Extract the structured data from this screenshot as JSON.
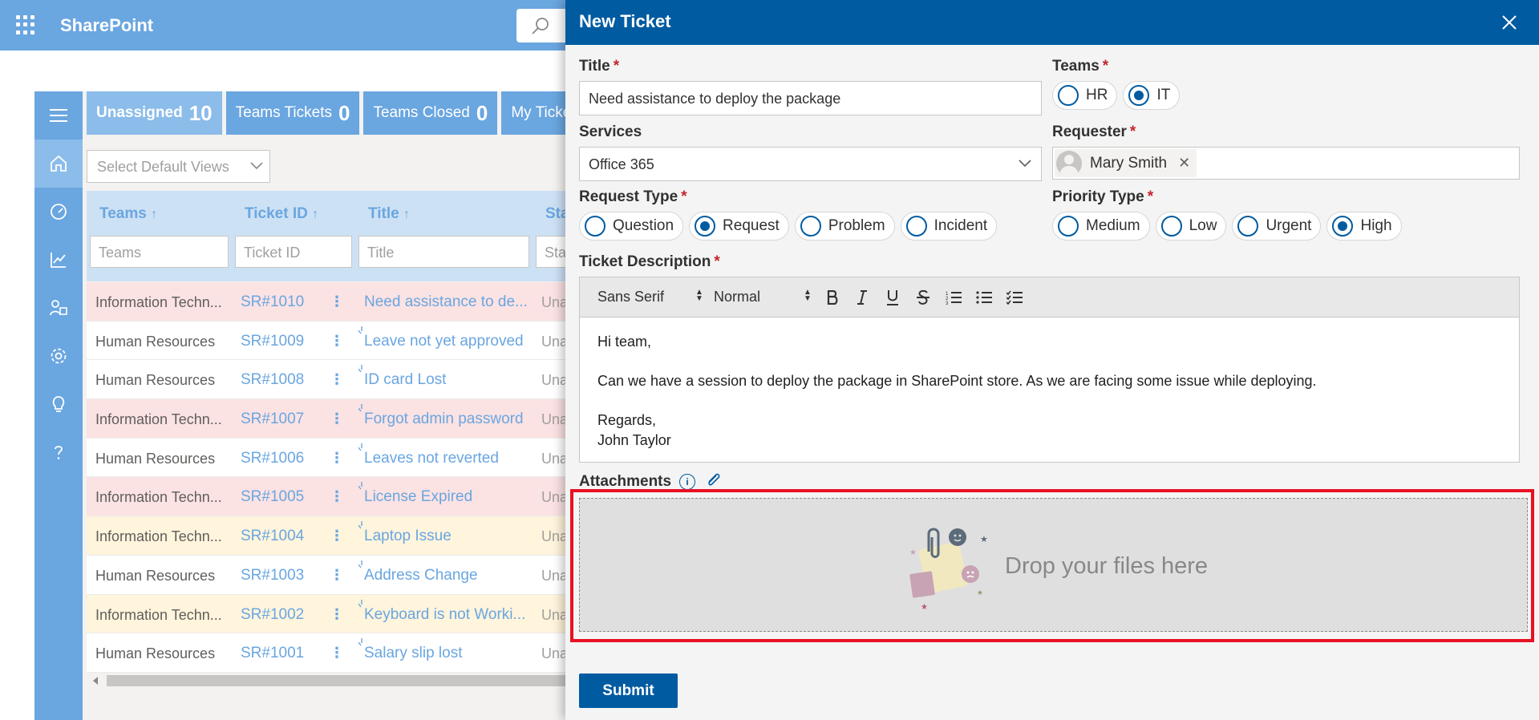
{
  "app": {
    "brand": "SharePoint"
  },
  "tabs": [
    {
      "label": "Unassigned",
      "count": "10"
    },
    {
      "label": "Teams Tickets",
      "count": "0"
    },
    {
      "label": "Teams Closed",
      "count": "0"
    },
    {
      "label": "My Tickets",
      "count": ""
    }
  ],
  "views": {
    "placeholder": "Select Default Views"
  },
  "grid": {
    "columns": [
      "Teams",
      "Ticket ID",
      "Title",
      "Sta"
    ],
    "sort_icon": "↑",
    "filters": [
      "Teams",
      "Ticket ID",
      "Title",
      "Sta"
    ],
    "rows": [
      {
        "team": "Information Techn...",
        "id": "SR#1010",
        "title": "Need assistance to de...",
        "status": "Una",
        "tone": "red"
      },
      {
        "team": "Human Resources",
        "id": "SR#1009",
        "title": "Leave not yet approved",
        "status": "Una",
        "tone": "white"
      },
      {
        "team": "Human Resources",
        "id": "SR#1008",
        "title": "ID card Lost",
        "status": "Una",
        "tone": "white"
      },
      {
        "team": "Information Techn...",
        "id": "SR#1007",
        "title": "Forgot admin password",
        "status": "Una",
        "tone": "red"
      },
      {
        "team": "Human Resources",
        "id": "SR#1006",
        "title": "Leaves not reverted",
        "status": "Una",
        "tone": "white"
      },
      {
        "team": "Information Techn...",
        "id": "SR#1005",
        "title": "License Expired",
        "status": "Una",
        "tone": "red"
      },
      {
        "team": "Information Techn...",
        "id": "SR#1004",
        "title": "Laptop Issue",
        "status": "Una",
        "tone": "yellow"
      },
      {
        "team": "Human Resources",
        "id": "SR#1003",
        "title": "Address Change",
        "status": "Una",
        "tone": "white"
      },
      {
        "team": "Information Techn...",
        "id": "SR#1002",
        "title": "Keyboard is not Worki...",
        "status": "Una",
        "tone": "yellow"
      },
      {
        "team": "Human Resources",
        "id": "SR#1001",
        "title": "Salary slip lost",
        "status": "Una",
        "tone": "white"
      }
    ]
  },
  "panel": {
    "title": "New Ticket",
    "required_mark": "*",
    "title_field": {
      "label": "Title",
      "value": "Need assistance to deploy the package"
    },
    "teams": {
      "label": "Teams",
      "options": [
        "HR",
        "IT"
      ],
      "selected": "IT"
    },
    "services": {
      "label": "Services",
      "value": "Office 365"
    },
    "requester": {
      "label": "Requester",
      "name": "Mary Smith",
      "remove": "✕"
    },
    "request_type": {
      "label": "Request Type",
      "options": [
        "Question",
        "Request",
        "Problem",
        "Incident"
      ],
      "selected": "Request"
    },
    "priority_type": {
      "label": "Priority Type",
      "options": [
        "Medium",
        "Low",
        "Urgent",
        "High"
      ],
      "selected": "High"
    },
    "description": {
      "label": "Ticket Description",
      "font": "Sans Serif",
      "size": "Normal",
      "lines": [
        "Hi team,",
        "",
        "Can we have a session to deploy the package in SharePoint store. As we are facing some issue while deploying.",
        "",
        "Regards,",
        "John Taylor"
      ]
    },
    "attachments": {
      "label": "Attachments",
      "info": "i",
      "drop_text": "Drop your files here"
    },
    "submit_label": "Submit"
  },
  "colors": {
    "accent": "#005ba1",
    "header_light": "#6aa6e0",
    "required": "#c4262e",
    "highlight": "#e81123"
  }
}
